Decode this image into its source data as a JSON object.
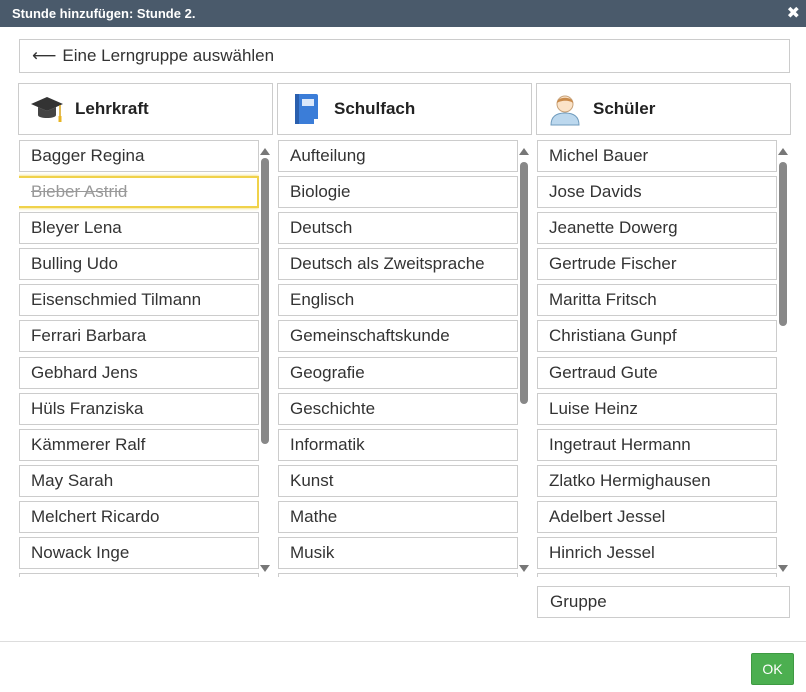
{
  "dialog": {
    "title": "Stunde hinzufügen: Stunde 2.",
    "close_glyph": "✖"
  },
  "back": {
    "arrow": "⟵",
    "label": "Eine Lerngruppe auswählen"
  },
  "columns": {
    "teacher": {
      "title": "Lehrkraft",
      "icon": "graduation-cap-icon",
      "items": [
        "Bagger Regina",
        "Bieber Astrid",
        "Bleyer Lena",
        "Bulling Udo",
        "Eisenschmied Tilmann",
        "Ferrari Barbara",
        "Gebhard Jens",
        "Hüls Franziska",
        "Kämmerer Ralf",
        "May Sarah",
        "Melchert Ricardo",
        "Nowack Inge"
      ],
      "selected_index": 1
    },
    "subject": {
      "title": "Schulfach",
      "icon": "book-icon",
      "items": [
        "Aufteilung",
        "Biologie",
        "Deutsch",
        "Deutsch als Zweitsprache",
        "Englisch",
        "Gemeinschaftskunde",
        "Geografie",
        "Geschichte",
        "Informatik",
        "Kunst",
        "Mathe",
        "Musik"
      ]
    },
    "student": {
      "title": "Schüler",
      "icon": "person-icon",
      "items": [
        "Michel Bauer",
        "Jose Davids",
        "Jeanette Dowerg",
        "Gertrude Fischer",
        "Maritta Fritsch",
        "Christiana Gunpf",
        "Gertraud Gute",
        "Luise Heinz",
        "Ingetraut Hermann",
        "Zlatko Hermighausen",
        "Adelbert Jessel",
        "Hinrich Jessel"
      ]
    }
  },
  "gruppe_label": "Gruppe",
  "ok_label": "OK",
  "colors": {
    "titlebar": "#4a5a6b",
    "ok": "#4caf50",
    "selected_border": "#f0d24a"
  }
}
